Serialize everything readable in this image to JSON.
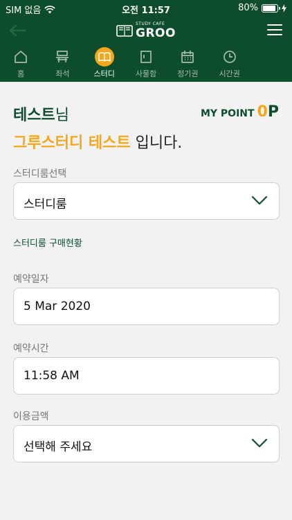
{
  "status_bar": {
    "carrier": "SIM 없음",
    "time": "오전 11:57",
    "battery_percent": "80%"
  },
  "header": {
    "logo_tag": "STUDY CAFE",
    "logo_name": "GROO"
  },
  "tabs": [
    {
      "label": "홈",
      "icon": "home-icon"
    },
    {
      "label": "좌석",
      "icon": "seat-icon"
    },
    {
      "label": "스터디",
      "icon": "book-icon",
      "active": true
    },
    {
      "label": "사물함",
      "icon": "locker-icon"
    },
    {
      "label": "정기권",
      "icon": "calendar-icon"
    },
    {
      "label": "시간권",
      "icon": "clock-icon"
    }
  ],
  "greeting": {
    "user_name": "테스트",
    "user_suffix": "님",
    "group_name": "그루스터디 테스트",
    "group_suffix": " 입니다."
  },
  "points": {
    "label": "MY POINT",
    "value": "0",
    "unit": "P"
  },
  "form": {
    "room_label": "스터디룸선택",
    "room_value": "스터디룸",
    "purchase_link": "스터디룸 구매현황",
    "date_label": "예약일자",
    "date_value": "5 Mar 2020",
    "time_label": "예약시간",
    "time_value": "11:58 AM",
    "price_label": "이용금액",
    "price_value": "선택해 주세요"
  },
  "colors": {
    "primary": "#0e4d2b",
    "accent": "#f3a71b",
    "background": "#f2f2f2"
  }
}
